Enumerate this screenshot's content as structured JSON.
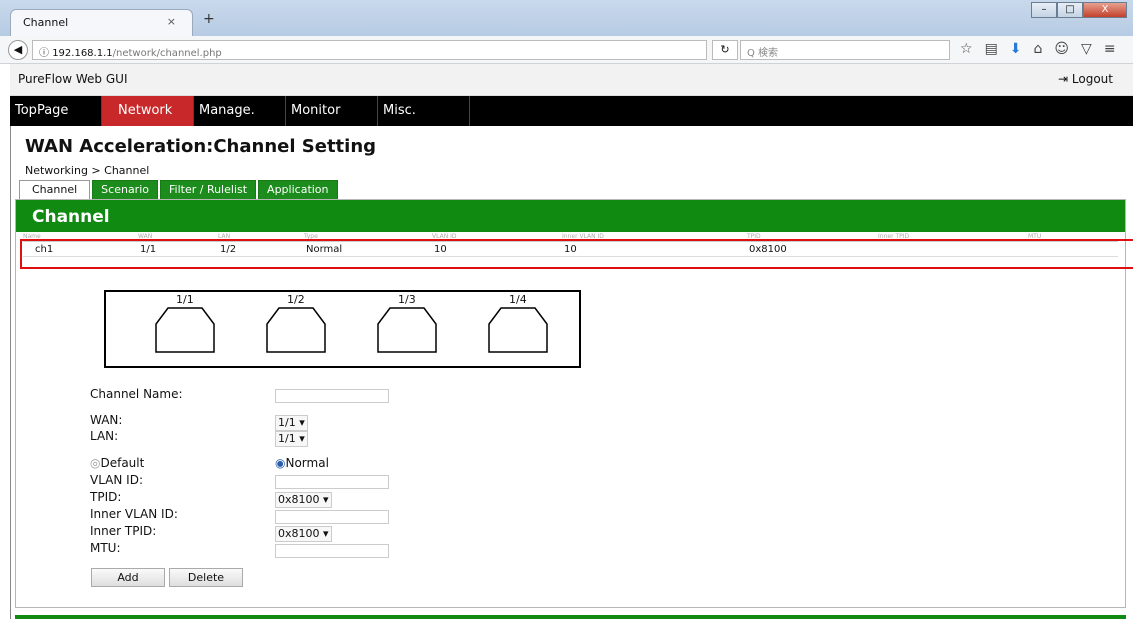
{
  "browser": {
    "tab_title": "Channel",
    "tab_close": "×",
    "new_tab": "+",
    "url_host": "192.168.1.1",
    "url_path": "/network/channel.php",
    "search_placeholder": "Q 検索",
    "win_min": "–",
    "win_max": "□",
    "win_close": "X",
    "icons": [
      "star-icon",
      "bookmarks-icon",
      "download-icon",
      "home-icon",
      "chat-icon",
      "pocket-icon",
      "menu-icon"
    ]
  },
  "app": {
    "title": "PureFlow Web GUI",
    "logout_label": "Logout"
  },
  "menu": [
    "TopPage",
    "Network",
    "Manage.",
    "Monitor",
    "Misc."
  ],
  "page": {
    "title": "WAN Acceleration:Channel Setting",
    "breadcrumb": "Networking > Channel"
  },
  "tabs": [
    "Channel",
    "Scenario",
    "Filter / Rulelist",
    "Application"
  ],
  "panel": {
    "header": "Channel"
  },
  "table": {
    "columns": [
      "Name",
      "WAN",
      "LAN",
      "Type",
      "VLAN ID",
      "Inner VLAN ID",
      "TPID",
      "Inner TPID",
      "MTU"
    ],
    "rows": [
      [
        "ch1",
        "1/1",
        "1/2",
        "Normal",
        "10",
        "10",
        "0x8100",
        "",
        ""
      ]
    ]
  },
  "ports": [
    "1/1",
    "1/2",
    "1/3",
    "1/4"
  ],
  "form": {
    "channel_name_label": "Channel Name:",
    "wan_label": "WAN:",
    "wan_value": "1/1 ▾",
    "lan_label": "LAN:",
    "lan_value": "1/1 ▾",
    "radio_default": "Default",
    "radio_normal": "Normal",
    "vlan_label": "VLAN ID:",
    "tpid_label": "TPID:",
    "tpid_value": "0x8100 ▾",
    "inner_vlan_label": "Inner VLAN ID:",
    "inner_tpid_label": "Inner TPID:",
    "inner_tpid_value": "0x8100 ▾",
    "mtu_label": "MTU:",
    "add_label": "Add",
    "delete_label": "Delete"
  },
  "colors": {
    "accent_green": "#108a10",
    "menu_active": "#c8282a",
    "highlight_red": "#e01010"
  }
}
